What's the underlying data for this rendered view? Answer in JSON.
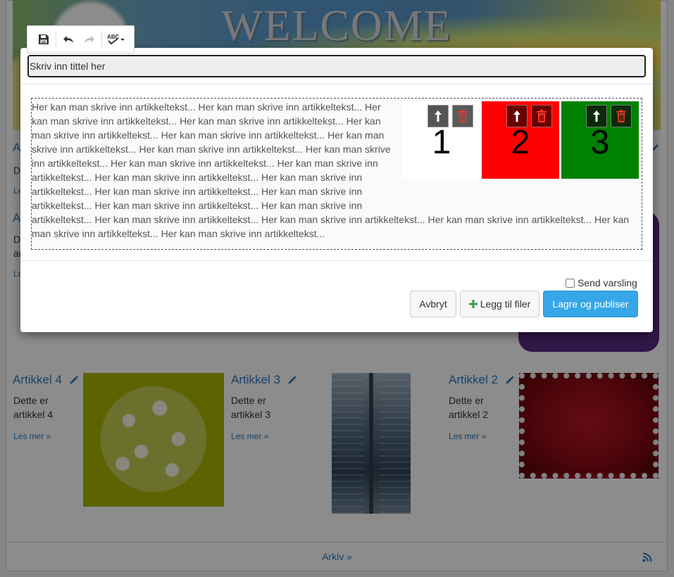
{
  "background": {
    "banner_title": "WELCOME",
    "articles": [
      {
        "title": "Artikkel 4",
        "text_line1": "Dette er",
        "text_line2": "artikkel 4",
        "more": "Les mer »"
      },
      {
        "title": "Artikkel 3",
        "text_line1": "Dette er",
        "text_line2": "artikkel 3",
        "more": "Les mer »"
      },
      {
        "title": "Artikkel 2",
        "text_line1": "Dette er",
        "text_line2": "artikkel 2",
        "more": "Les mer »"
      }
    ],
    "partial": {
      "a1": "A",
      "a2": "D",
      "a3": "Le",
      "a4": "A",
      "a5": "D",
      "a6": "ar",
      "a7": "Le"
    },
    "footer_link": "Arkiv »"
  },
  "toolbar": {
    "icons": [
      "save-icon",
      "undo-icon",
      "redo-icon",
      "spellcheck-icon"
    ]
  },
  "modal": {
    "title_input": {
      "value": "Skriv inn tittel her"
    },
    "body_text": "Her kan man skrive inn artikkeltekst... Her kan man skrive inn artikkeltekst... Her kan man skrive inn artikkeltekst... Her kan man skrive inn artikkeltekst... Her kan man skrive inn artikkeltekst... Her kan man skrive inn artikkeltekst... Her kan man skrive inn artikkeltekst... Her kan man skrive inn artikkeltekst... Her kan man skrive inn artikkeltekst... Her kan man skrive inn artikkeltekst... Her kan man skrive inn artikkeltekst... Her kan man skrive inn artikkeltekst... Her kan man skrive inn artikkeltekst... Her kan man skrive inn artikkeltekst... Her kan man skrive inn artikkeltekst... Her kan man skrive inn artikkeltekst... Her kan man skrive inn artikkeltekst... Her kan man skrive inn artikkeltekst... Her kan man skrive inn artikkeltekst... Her kan man skrive inn artikkeltekst... Her kan man skrive inn artikkeltekst... Her kan man skrive inn artikkeltekst...",
    "images": [
      {
        "label": "1",
        "bg": "#ffffff"
      },
      {
        "label": "2",
        "bg": "#ff0000"
      },
      {
        "label": "3",
        "bg": "#008000"
      }
    ],
    "notify_label": "Send varsling",
    "notify_checked": false,
    "buttons": {
      "cancel": "Avbryt",
      "add_files": "Legg til filer",
      "save_publish": "Lagre og publiser"
    }
  },
  "colors": {
    "link": "#2a79bd",
    "primary": "#35a6e8",
    "delete_icon": "#e0362c",
    "add_icon": "#2ea44f"
  }
}
